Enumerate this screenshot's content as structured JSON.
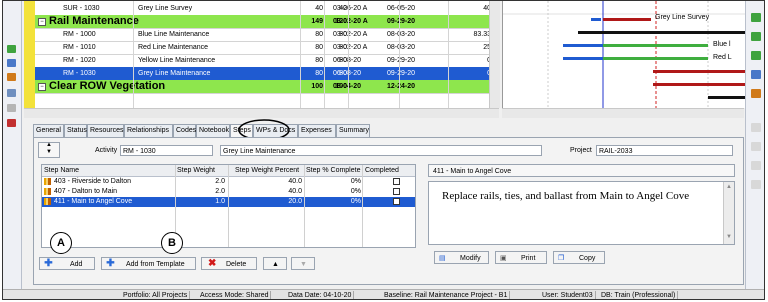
{
  "activities": [
    {
      "id": "SUR - 1030",
      "name": "Grey Line Survey",
      "d1": "40",
      "d2": "40",
      "start": "03-26-20 A",
      "finish": "06-05-20",
      "cost": "40",
      "type": "normal"
    },
    {
      "id": "",
      "name": "Rail Maintenance",
      "d1": "149",
      "d2": "120",
      "start": "03-02-20 A",
      "finish": "09-29-20",
      "cost": "",
      "type": "group"
    },
    {
      "id": "RM - 1000",
      "name": "Blue Line Maintenance",
      "d1": "80",
      "d2": "80",
      "start": "03-02-20 A",
      "finish": "08-03-20",
      "cost": "83.33",
      "type": "normal"
    },
    {
      "id": "RM - 1010",
      "name": "Red Line Maintenance",
      "d1": "80",
      "d2": "80",
      "start": "03-02-20 A",
      "finish": "08-03-20",
      "cost": "25",
      "type": "normal"
    },
    {
      "id": "RM - 1020",
      "name": "Yellow Line Maintenance",
      "d1": "80",
      "d2": "80",
      "start": "06-08-20",
      "finish": "09-29-20",
      "cost": "0",
      "type": "normal"
    },
    {
      "id": "RM - 1030",
      "name": "Grey Line Maintenance",
      "d1": "80",
      "d2": "80",
      "start": "06-08-20",
      "finish": "09-29-20",
      "cost": "0",
      "type": "selected"
    },
    {
      "id": "",
      "name": "Clear ROW Vegetation",
      "d1": "100",
      "d2": "100",
      "start": "08-04-20",
      "finish": "12-24-20",
      "cost": "",
      "type": "group"
    }
  ],
  "gantt_labels": [
    "Grey Line Survey",
    "Blue l",
    "Red L"
  ],
  "tabs": [
    "General",
    "Status",
    "Resources",
    "Relationships",
    "Codes",
    "Notebook",
    "Steps",
    "WPs & Docs",
    "Expenses",
    "Summary"
  ],
  "detail": {
    "activity_label": "Activity",
    "activity_id": "RM - 1030",
    "activity_name": "Grey Line Maintenance",
    "project_label": "Project",
    "project_value": "RAIL-2033"
  },
  "steps_table": {
    "headers": [
      "Step Name",
      "Step Weight",
      "Step Weight Percent",
      "Step % Complete",
      "Completed"
    ],
    "rows": [
      {
        "name": "403 - Riverside to Dalton",
        "weight": "2.0",
        "percent": "40.0",
        "complete": "0%"
      },
      {
        "name": "407 - Dalton to Main",
        "weight": "2.0",
        "percent": "40.0",
        "complete": "0%"
      },
      {
        "name": "411 - Main to Angel Cove",
        "weight": "1.0",
        "percent": "20.0",
        "complete": "0%"
      }
    ]
  },
  "description": {
    "title": "411 - Main to Angel Cove",
    "text": "Replace rails, ties, and ballast from Main to Angel Cove"
  },
  "buttons": {
    "add": "Add",
    "add_template": "Add from Template",
    "delete": "Delete",
    "modify": "Modify",
    "print": "Print",
    "copy": "Copy"
  },
  "annotations": {
    "a": "A",
    "b": "B"
  },
  "statusbar": {
    "portfolio": "Portfolio: All Projects",
    "access": "Access Mode: Shared",
    "date": "Data Date: 04-10-20",
    "baseline": "Baseline: Rail Maintenance Project - B1",
    "user": "User: Student03",
    "db": "DB: Train (Professional)"
  },
  "colors": {
    "group_row": "#8ee64d",
    "selected_row": "#1f5bd1",
    "gantt_red": "#b01818",
    "gantt_green": "#3fae3f",
    "gantt_black": "#111111"
  }
}
